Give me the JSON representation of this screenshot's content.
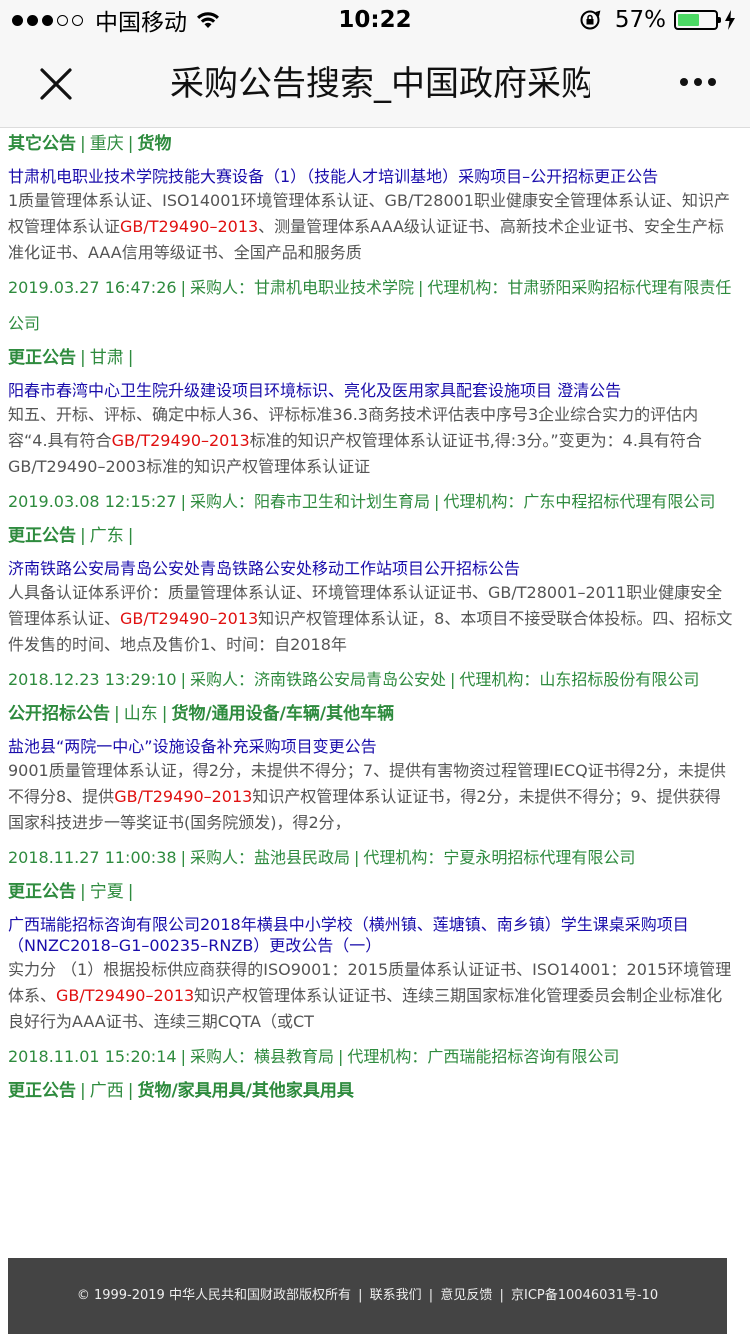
{
  "status_bar": {
    "signal_dots_full": 3,
    "signal_dots_empty": 2,
    "carrier": "中国移动",
    "time": "10:22",
    "battery_percent": "57%",
    "battery_level": 0.57,
    "battery_color": "#4cd964"
  },
  "nav": {
    "title": "采购公告搜索_中国政府采购"
  },
  "results": [
    {
      "prev_cat": {
        "type": "其它公告",
        "region": "重庆",
        "category": "货物"
      },
      "title": "甘肃机电职业技术学院技能大赛设备（1）（技能人才培训基地）采购项目–公开招标更正公告",
      "snippet_before": "1质量管理体系认证、ISO14001环境管理体系认证、GB/T28001职业健康安全管理体系认证、知识产权管理体系认证",
      "highlight": "GB/T29490–2013",
      "snippet_after": "、测量管理体系AAA级认证证书、高新技术企业证书、安全生产标准化证书、AAA信用等级证书、全国产品和服务质",
      "date": "2019.03.27 16:47:26",
      "buyer_label": "采购人：",
      "buyer": "甘肃机电职业技术学院",
      "agency_label": "代理机构：",
      "agency": "甘肃骄阳采购招标代理有限责任公司",
      "cat": {
        "type": "更正公告",
        "region": "甘肃",
        "category": ""
      }
    },
    {
      "title": "阳春市春湾中心卫生院升级建设项目环境标识、亮化及医用家具配套设施项目 澄清公告",
      "snippet_before": "知五、开标、评标、确定中标人36、评标标准36.3商务技术评估表中序号3企业综合实力的评估内容“4.具有符合",
      "highlight": "GB/T29490–2013",
      "snippet_after": "标准的知识产权管理体系认证证书,得:3分。”变更为：4.具有符合GB/T29490–2003标准的知识产权管理体系认证证",
      "date": "2019.03.08 12:15:27",
      "buyer_label": "采购人：",
      "buyer": "阳春市卫生和计划生育局",
      "agency_label": "代理机构：",
      "agency": "广东中程招标代理有限公司",
      "cat": {
        "type": "更正公告",
        "region": "广东",
        "category": ""
      }
    },
    {
      "title": "济南铁路公安局青岛公安处青岛铁路公安处移动工作站项目公开招标公告",
      "snippet_before": "人具备认证体系评价：质量管理体系认证、环境管理体系认证证书、GB/T28001–2011职业健康安全管理体系认证、",
      "highlight": "GB/T29490–2013",
      "snippet_after": "知识产权管理体系认证，8、本项目不接受联合体投标。四、招标文件发售的时间、地点及售价1、时间：自2018年",
      "date": "2018.12.23 13:29:10",
      "buyer_label": "采购人：",
      "buyer": "济南铁路公安局青岛公安处",
      "agency_label": "代理机构：",
      "agency": "山东招标股份有限公司",
      "cat": {
        "type": "公开招标公告",
        "region": "山东",
        "category": "货物/通用设备/车辆/其他车辆"
      }
    },
    {
      "title": "盐池县“两院一中心”设施设备补充采购项目变更公告",
      "snippet_before": "9001质量管理体系认证，得2分，未提供不得分；7、提供有害物资过程管理IECQ证书得2分，未提供不得分8、提供",
      "highlight": "GB/T29490–2013",
      "snippet_after": "知识产权管理体系认证证书，得2分，未提供不得分；9、提供获得国家科技进步一等奖证书(国务院颁发)，得2分，",
      "date": "2018.11.27 11:00:38",
      "buyer_label": "采购人：",
      "buyer": "盐池县民政局",
      "agency_label": "代理机构：",
      "agency": "宁夏永明招标代理有限公司",
      "cat": {
        "type": "更正公告",
        "region": "宁夏",
        "category": ""
      }
    },
    {
      "title": "广西瑞能招标咨询有限公司2018年横县中小学校（横州镇、莲塘镇、南乡镇）学生课桌采购项目（NNZC2018–G1–00235–RNZB）更改公告（一）",
      "snippet_before": "实力分 （1）根据投标供应商获得的ISO9001：2015质量体系认证证书、ISO14001：2015环境管理体系、",
      "highlight": "GB/T29490–2013",
      "snippet_after": "知识产权管理体系认证证书、连续三期国家标准化管理委员会制企业标准化良好行为AAA证书、连续三期CQTA（或CT",
      "date": "2018.11.01 15:20:14",
      "buyer_label": "采购人：",
      "buyer": "横县教育局",
      "agency_label": "代理机构：",
      "agency": "广西瑞能招标咨询有限公司",
      "cat": {
        "type": "更正公告",
        "region": "广西",
        "category": "货物/家具用具/其他家具用具"
      }
    }
  ],
  "footer": {
    "copyright": "© 1999-2019 中华人民共和国财政部版权所有",
    "contact": "联系我们",
    "feedback": "意见反馈",
    "icp": "京ICP备10046031号-10"
  },
  "colors": {
    "accent_green": "#2e8b3e",
    "link_blue": "#1a0dab",
    "highlight_red": "#e01010",
    "footer_bg": "#444444"
  },
  "icons": [
    "wifi-icon",
    "rotation-lock-icon",
    "charging-bolt-icon",
    "close-icon",
    "more-icon"
  ]
}
